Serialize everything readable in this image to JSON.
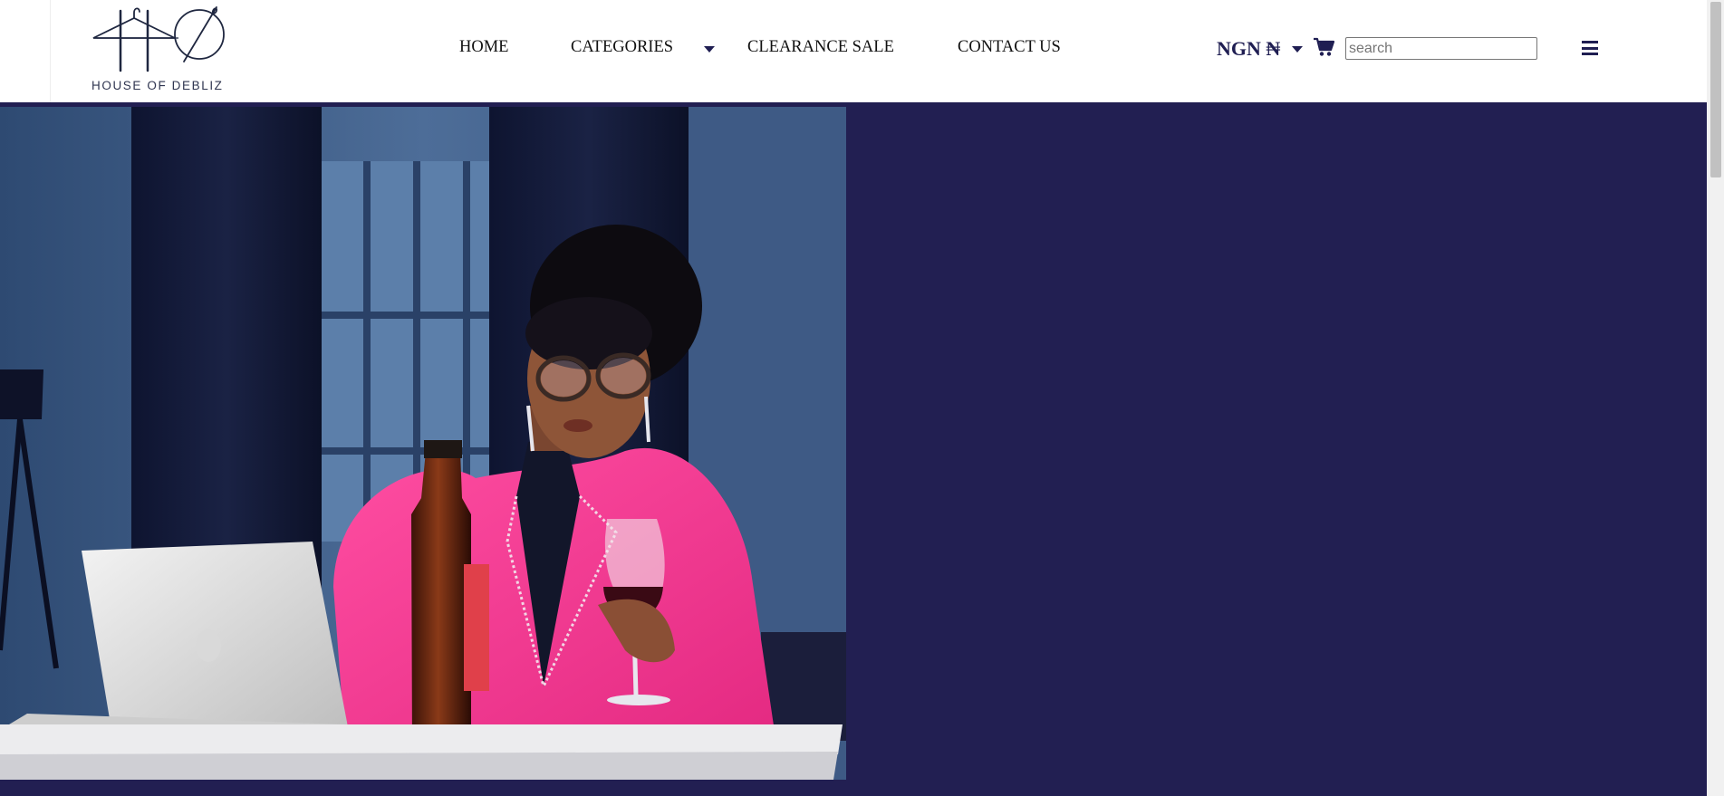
{
  "brand": {
    "name": "HOUSE OF DEBLIZ",
    "logo_icon": "hanger-needle-monogram-icon"
  },
  "nav": {
    "home": "HOME",
    "categories": "CATEGORIES",
    "clearance_sale": "CLEARANCE SALE",
    "contact_us": "CONTACT US"
  },
  "header_actions": {
    "currency": "NGN ₦",
    "cart_icon": "cart-icon",
    "search_placeholder": "search",
    "menu_icon": "hamburger-menu-icon"
  },
  "hero": {
    "background_color": "#221f52",
    "image_subject": "hero-photo-woman-in-pink-blazer"
  },
  "colors": {
    "brand_navy": "#1f1e52",
    "hero_bg": "#221f52",
    "accent_pink": "#ec2f8b"
  }
}
